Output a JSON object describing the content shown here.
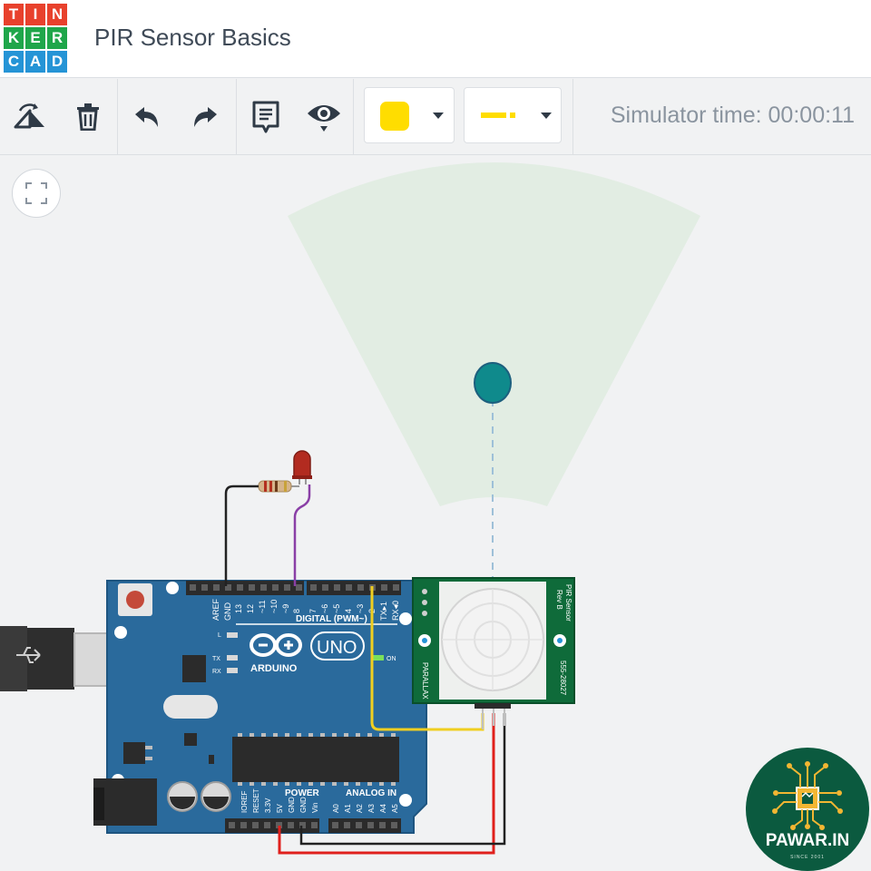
{
  "app": {
    "logo_letters": [
      "T",
      "I",
      "N",
      "K",
      "E",
      "R",
      "C",
      "A",
      "D"
    ],
    "logo_colors": [
      "#e8412c",
      "#e8412c",
      "#e8412c",
      "#1fa64a",
      "#1fa64a",
      "#1fa64a",
      "#2594d6",
      "#2594d6",
      "#2594d6"
    ],
    "project_title": "PIR Sensor Basics"
  },
  "toolbar": {
    "buttons": [
      {
        "name": "rotate-icon"
      },
      {
        "name": "delete-icon"
      },
      {
        "name": "undo-icon"
      },
      {
        "name": "redo-icon"
      },
      {
        "name": "notes-icon"
      },
      {
        "name": "visibility-icon"
      }
    ],
    "color_picker": {
      "selected_color": "#ffdd00",
      "icon": "chevron-down-icon"
    },
    "wire_picker": {
      "selected_color": "#ffdd00",
      "icon": "chevron-down-icon"
    },
    "simulator_time": "Simulator time: 00:00:11"
  },
  "canvas": {
    "fit_button_icon": "fit-view-icon",
    "pir_range_color": "#e2ede3",
    "target_color": "#0f8a8c",
    "arduino": {
      "brand": "ARDUINO",
      "model": "UNO",
      "header_digital": "DIGITAL (PWM~)",
      "power_label": "POWER",
      "analog_label": "ANALOG IN",
      "pin_labels_top": [
        "AREF",
        "GND",
        "13",
        "12",
        "~11",
        "~10",
        "~9",
        "8",
        "7",
        "~6",
        "~5",
        "4",
        "~3",
        "2",
        "TX▸1",
        "RX◂0"
      ],
      "pin_labels_power": [
        "IOREF",
        "RESET",
        "3.3V",
        "5V",
        "GND",
        "GND",
        "Vin"
      ],
      "pin_labels_analog": [
        "A0",
        "A1",
        "A2",
        "A3",
        "A4",
        "A5"
      ],
      "led_labels": [
        "L",
        "TX",
        "RX",
        "ON"
      ],
      "color": "#2a6a9c"
    },
    "pir_sensor": {
      "label_left": "PARALLAX",
      "label_right_1": "PIR Sensor",
      "label_right_2": "Rev B",
      "label_right_3": "555-28027"
    },
    "wires": [
      {
        "name": "wire-black-gnd",
        "color": "#222222"
      },
      {
        "name": "wire-purple-pin8",
        "color": "#8a3fa6"
      },
      {
        "name": "wire-yellow-signal",
        "color": "#f0cf20"
      },
      {
        "name": "wire-red-5v",
        "color": "#e0201c"
      },
      {
        "name": "wire-black-pir-gnd",
        "color": "#222222"
      }
    ]
  },
  "badge": {
    "name": "PAWAR.IN",
    "since": "SINCE 2001"
  }
}
